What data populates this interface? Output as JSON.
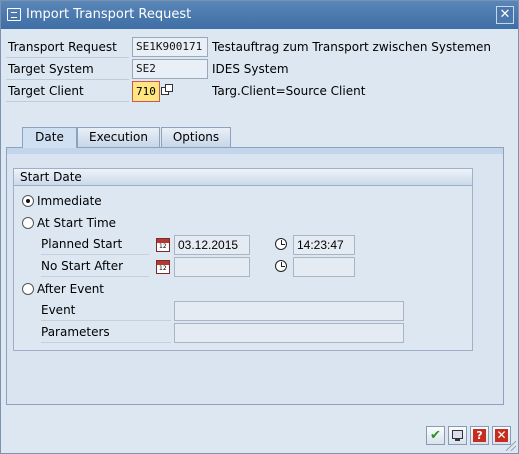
{
  "window": {
    "title": "Import Transport Request",
    "close_glyph": "✕"
  },
  "header_fields": {
    "transport_request": {
      "label": "Transport Request",
      "value": "SE1K900171",
      "description": "Testauftrag zum Transport zwischen Systemen S..."
    },
    "target_system": {
      "label": "Target System",
      "value": "SE2",
      "description": "IDES System"
    },
    "target_client": {
      "label": "Target Client",
      "value": "710",
      "description": "Targ.Client=Source Client"
    }
  },
  "tabs": [
    {
      "label": "Date",
      "active": true
    },
    {
      "label": "Execution",
      "active": false
    },
    {
      "label": "Options",
      "active": false
    }
  ],
  "start_date": {
    "group_title": "Start Date",
    "options": {
      "immediate": {
        "label": "Immediate",
        "checked": true
      },
      "at_start_time": {
        "label": "At Start Time",
        "checked": false
      },
      "after_event": {
        "label": "After Event",
        "checked": false
      }
    },
    "planned_start": {
      "label": "Planned Start",
      "date": "03.12.2015",
      "time": "14:23:47"
    },
    "no_start_after": {
      "label": "No Start After",
      "date": "",
      "time": ""
    },
    "event": {
      "label": "Event",
      "value": ""
    },
    "parameters": {
      "label": "Parameters",
      "value": ""
    }
  },
  "icons": {
    "calendar_text": "12",
    "ok_glyph": "✔",
    "help_glyph": "?",
    "cancel_glyph": "✕"
  },
  "colors": {
    "titlebar": "#3e6ea5",
    "required_field": "#ffe680",
    "cancel_red": "#c62d1f",
    "ok_green": "#2c8f1f"
  }
}
